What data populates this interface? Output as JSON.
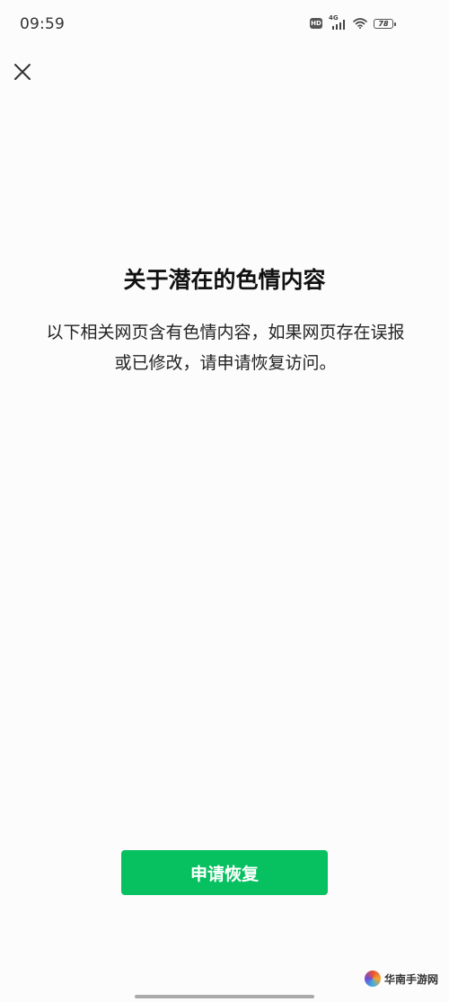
{
  "status_bar": {
    "time": "09:59",
    "hd_label": "HD",
    "network_label": "4G",
    "battery_level": "78",
    "icons": [
      "hd-icon",
      "signal-4g-icon",
      "wifi-icon",
      "battery-icon"
    ]
  },
  "header": {
    "close_icon": "close-icon"
  },
  "content": {
    "title": "关于潜在的色情内容",
    "description": "以下相关网页含有色情内容，如果网页存在误报或已修改，请申请恢复访问。"
  },
  "actions": {
    "restore_label": "申请恢复"
  },
  "watermark": {
    "text": "华南手游网"
  },
  "colors": {
    "accent": "#07c160",
    "background": "#fcfcfc",
    "text": "#1a1a1a"
  }
}
